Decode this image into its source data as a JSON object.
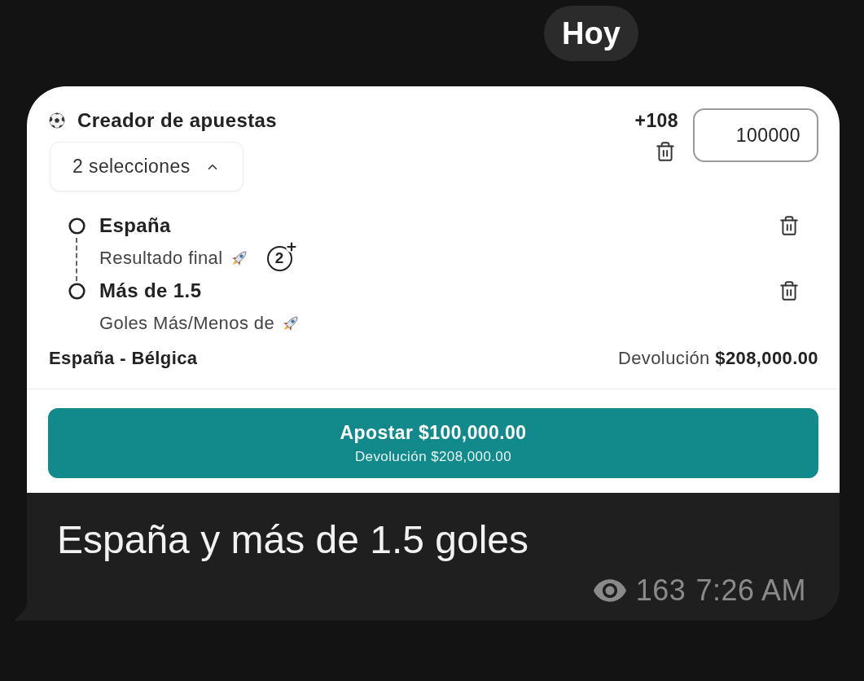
{
  "date_chip": {
    "label": "Hoy"
  },
  "message": {
    "bet_builder": {
      "title": "Creador de apuestas",
      "selections_toggle": {
        "label": "2 selecciones",
        "expanded": true
      },
      "odds": "+108",
      "stake": {
        "value": "100000"
      },
      "selections": [
        {
          "name": "España",
          "market": "Resultado final",
          "badge": "2"
        },
        {
          "name": "Más de 1.5",
          "market": "Goles Más/Menos de"
        }
      ],
      "match": "España - Bélgica",
      "payout": "Devolución **$208,000.00**",
      "place_bet_button": {
        "label": "Apostar $100,000.00",
        "sublabel": "Devolución $208,000.00"
      }
    },
    "caption": "España y más de 1.5 goles",
    "views": "163",
    "time": "7:26 AM"
  }
}
